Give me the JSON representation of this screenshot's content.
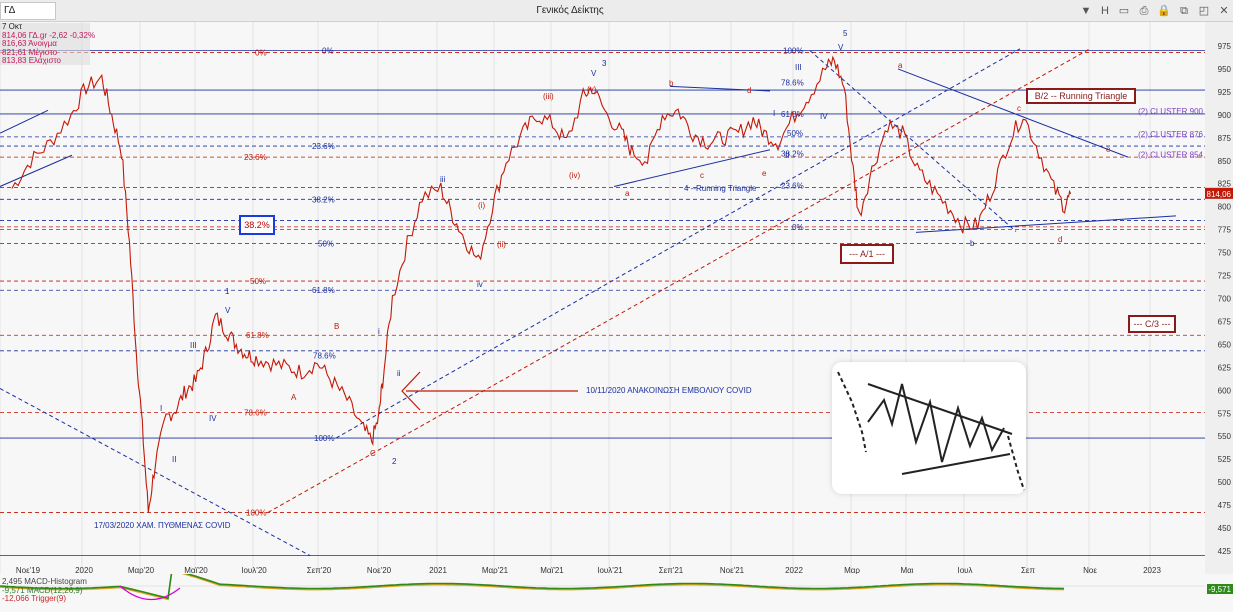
{
  "window": {
    "symbol": "ΓΔ",
    "title": "Γενικός Δείκτης",
    "buttons": [
      "H",
      "▭",
      "⎙",
      "🔒",
      "⧉",
      "◰",
      "✕"
    ]
  },
  "info": {
    "date": "7 Οκτ",
    "last": "814,06 ΓΔ.gr -2,62 -0,32%",
    "open": "816,63 Άνοιγμα",
    "high": "821,61 Μέγιστο",
    "low": "813,83 Ελάχιστο"
  },
  "price_tag": "814,06",
  "macd": {
    "hist_label": "2,495 MACD-Histogram",
    "macd_label": "-9,571 MACD(12,26,9)",
    "trigger_label": "-12,066 Trigger(9)",
    "right_tag": "-9,571"
  },
  "colors": {
    "price": "#c21807",
    "blue_line": "#1a2fa0",
    "red_line": "#c21807",
    "purple": "#7b3fc4",
    "macd_green": "#2e8b1a",
    "macd_orange": "#e0a020"
  },
  "chart_data": {
    "type": "line",
    "title": "Γενικός Δείκτης",
    "x_ticks": [
      "Νοε'19",
      "2020",
      "Μαρ'20",
      "Μαϊ'20",
      "Ιουλ'20",
      "Σεπ'20",
      "Νοε'20",
      "2021",
      "Μαρ'21",
      "Μαϊ'21",
      "Ιουλ'21",
      "Σεπ'21",
      "Νοε'21",
      "2022",
      "Μαρ",
      "Μαι",
      "Ιουλ",
      "Σεπ",
      "Νοε",
      "2023"
    ],
    "y_ticks": [
      975,
      950,
      925,
      900,
      875,
      850,
      825,
      800,
      775,
      750,
      725,
      700,
      675,
      650,
      625,
      600,
      575,
      550,
      525,
      500,
      475,
      450,
      425
    ],
    "ylim": [
      412,
      990
    ],
    "series": [
      {
        "x": [
          "2019-11-01",
          "2019-11-20",
          "2019-12-10",
          "2019-12-31",
          "2020-01-15",
          "2020-01-31",
          "2020-02-10",
          "2020-02-20",
          "2020-02-28",
          "2020-03-06",
          "2020-03-12",
          "2020-03-18",
          "2020-03-25",
          "2020-04-05",
          "2020-04-15",
          "2020-04-25",
          "2020-05-05",
          "2020-05-15",
          "2020-05-25",
          "2020-06-05",
          "2020-06-15",
          "2020-06-25",
          "2020-07-05",
          "2020-07-20",
          "2020-08-05",
          "2020-08-20",
          "2020-09-05",
          "2020-09-20",
          "2020-10-05",
          "2020-10-20",
          "2020-10-30",
          "2020-11-06",
          "2020-11-10",
          "2020-11-20",
          "2020-12-05",
          "2020-12-20",
          "2021-01-08",
          "2021-01-20",
          "2021-02-01",
          "2021-02-15",
          "2021-03-01",
          "2021-03-15",
          "2021-04-01",
          "2021-04-15",
          "2021-05-01",
          "2021-05-15",
          "2021-06-01",
          "2021-06-10",
          "2021-06-25",
          "2021-07-10",
          "2021-07-20",
          "2021-08-05",
          "2021-08-20",
          "2021-09-05",
          "2021-09-20",
          "2021-10-05",
          "2021-10-20",
          "2021-11-05",
          "2021-11-20",
          "2021-12-01",
          "2021-12-15",
          "2022-01-01",
          "2022-01-15",
          "2022-02-01",
          "2022-02-10",
          "2022-02-20",
          "2022-03-01",
          "2022-03-07",
          "2022-03-20",
          "2022-04-05",
          "2022-04-20",
          "2022-05-05",
          "2022-05-20",
          "2022-06-05",
          "2022-06-20",
          "2022-07-05",
          "2022-07-20",
          "2022-08-05",
          "2022-08-20",
          "2022-09-05",
          "2022-09-20",
          "2022-10-01",
          "2022-10-07"
        ],
        "y": [
          820,
          850,
          870,
          900,
          930,
          940,
          900,
          860,
          760,
          640,
          560,
          468,
          520,
          570,
          580,
          600,
          610,
          640,
          680,
          665,
          650,
          640,
          635,
          630,
          625,
          620,
          630,
          610,
          590,
          560,
          545,
          570,
          610,
          700,
          760,
          810,
          820,
          790,
          765,
          740,
          800,
          850,
          880,
          900,
          890,
          870,
          920,
          930,
          900,
          880,
          860,
          850,
          900,
          905,
          880,
          870,
          875,
          880,
          895,
          880,
          870,
          900,
          920,
          950,
          960,
          930,
          840,
          790,
          840,
          890,
          880,
          840,
          820,
          800,
          780,
          780,
          820,
          870,
          900,
          860,
          820,
          800,
          814
        ]
      }
    ],
    "horizontal_levels": [
      {
        "value": 970,
        "color": "blue"
      },
      {
        "value": 968,
        "color": "red",
        "label": "0%"
      },
      {
        "value": 927,
        "color": "blue"
      },
      {
        "value": 901,
        "color": "blue"
      },
      {
        "value": 876,
        "color": "blue"
      },
      {
        "value": 866,
        "color": "blue",
        "label": "23.6%"
      },
      {
        "value": 854,
        "color": "red",
        "label": "23.6%"
      },
      {
        "value": 821,
        "color": "blue"
      },
      {
        "value": 808,
        "color": "blue",
        "label": "38.2%"
      },
      {
        "value": 785,
        "color": "blue"
      },
      {
        "value": 778,
        "color": "red",
        "label": "38.2%"
      },
      {
        "value": 775,
        "color": "red"
      },
      {
        "value": 760,
        "color": "blue",
        "label": "50%"
      },
      {
        "value": 719,
        "color": "red",
        "label": "50%"
      },
      {
        "value": 709,
        "color": "blue",
        "label": "61.8%"
      },
      {
        "value": 660,
        "color": "red",
        "label": "61.8%"
      },
      {
        "value": 643,
        "color": "blue"
      },
      {
        "value": 576,
        "color": "red",
        "label": "78.6%"
      },
      {
        "value": 548,
        "color": "blue",
        "label": "100%"
      },
      {
        "value": 467,
        "color": "red",
        "label": "100%"
      },
      {
        "value": 420,
        "color": "blue"
      }
    ],
    "annotations": {
      "wave_labels": [
        "5",
        "3",
        "V",
        "(v)",
        "(iii)",
        "(iv)",
        "b",
        "d",
        "c",
        "e",
        "a",
        "I",
        "II",
        "III",
        "IV",
        "V",
        "a",
        "b",
        "c",
        "d",
        "e",
        "A",
        "B",
        "C",
        "I",
        "II",
        "III",
        "IV",
        "V",
        "1",
        "2",
        "(i)",
        "(ii)",
        "i",
        "ii",
        "iii",
        "iv"
      ],
      "cluster_labels": [
        "(2) CLUSTER 900",
        "(2) CLUSTER 876",
        "(2) CLUSTER 854"
      ],
      "box_labels": [
        "B/2  -- Running Triangle",
        "--- A/1 ---",
        "--- C/3 ---"
      ],
      "blue_box_label": "38.2%",
      "text": [
        "4 --Running Triangle",
        "10/11/2020  ΑΝΑΚΟΙΝΩΣΗ ΕΜΒΟΛΙΟΥ COVID",
        "17/03/2020  ΧΑΜ. ΠΥΘΜΕΝΑΣ COVID",
        "78.6%",
        "61.8%",
        "50%",
        "38.2%",
        "23.6%",
        "0%",
        "100%"
      ]
    }
  }
}
